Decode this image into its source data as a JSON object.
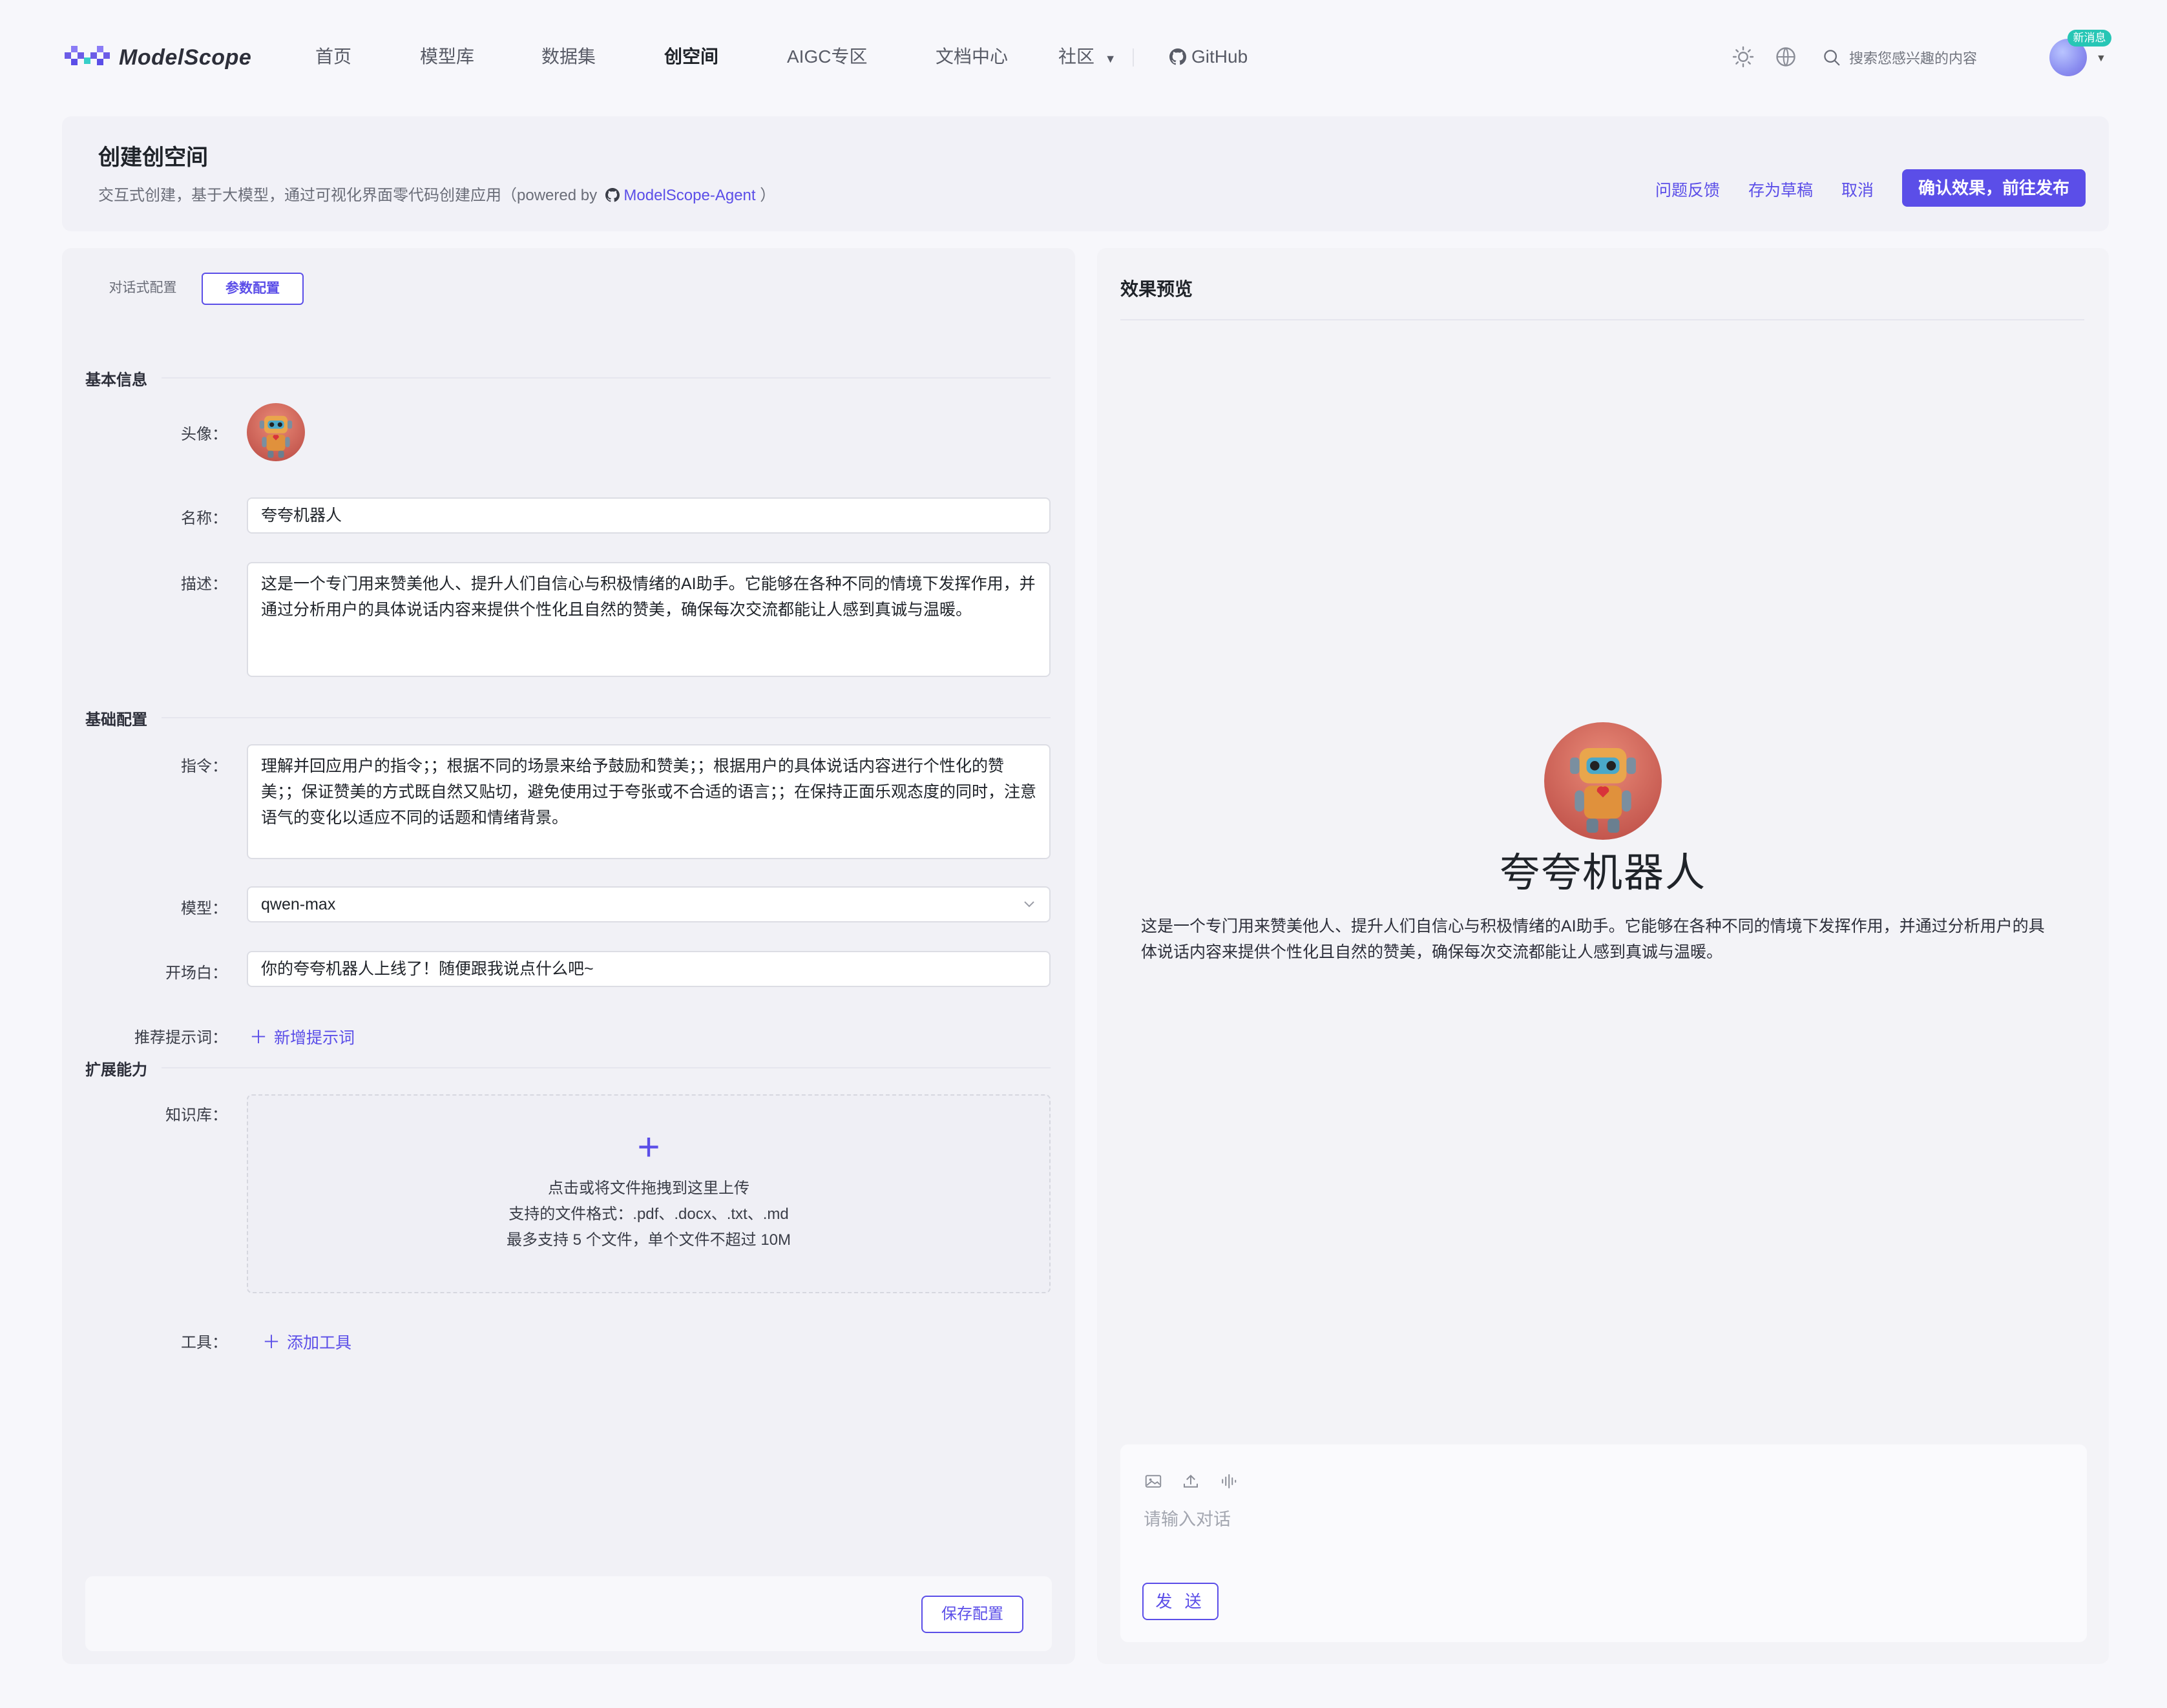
{
  "brand": {
    "name": "ModelScope"
  },
  "nav": {
    "items": [
      "首页",
      "模型库",
      "数据集",
      "创空间",
      "AIGC专区",
      "文档中心",
      "社区"
    ],
    "github": "GitHub",
    "search_placeholder": "搜索您感兴趣的内容",
    "new_badge": "新消息"
  },
  "header": {
    "title": "创建创空间",
    "subtitle_prefix": "交互式创建，基于大模型，通过可视化界面零代码创建应用（powered by",
    "subtitle_link": "ModelScope-Agent",
    "subtitle_suffix": "）",
    "feedback": "问题反馈",
    "save_draft": "存为草稿",
    "cancel": "取消",
    "publish": "确认效果，前往发布"
  },
  "config": {
    "tabs": [
      "对话式配置",
      "参数配置"
    ],
    "sections": {
      "basic_info": "基本信息",
      "basic_config": "基础配置",
      "extensions": "扩展能力"
    },
    "labels": {
      "avatar": "头像：",
      "name": "名称：",
      "description": "描述：",
      "instruction": "指令：",
      "model": "模型：",
      "opening": "开场白：",
      "suggested_prompts": "推荐提示词：",
      "knowledge": "知识库：",
      "tools": "工具："
    },
    "values": {
      "name": "夸夸机器人",
      "description": "这是一个专门用来赞美他人、提升人们自信心与积极情绪的AI助手。它能够在各种不同的情境下发挥作用，并通过分析用户的具体说话内容来提供个性化且自然的赞美，确保每次交流都能让人感到真诚与温暖。",
      "instruction": "理解并回应用户的指令；；根据不同的场景来给予鼓励和赞美；；根据用户的具体说话内容进行个性化的赞美；；保证赞美的方式既自然又贴切，避免使用过于夸张或不合适的语言；；在保持正面乐观态度的同时，注意语气的变化以适应不同的话题和情绪背景。",
      "model": "qwen-max",
      "opening": "你的夸夸机器人上线了！随便跟我说点什么吧~"
    },
    "add_prompt": "新增提示词",
    "upload": {
      "line1": "点击或将文件拖拽到这里上传",
      "line2": "支持的文件格式：.pdf、.docx、.txt、.md",
      "line3": "最多支持 5 个文件，单个文件不超过 10M"
    },
    "add_tool": "添加工具",
    "save": "保存配置"
  },
  "preview": {
    "title": "效果预览",
    "bot_name": "夸夸机器人",
    "bot_desc": "这是一个专门用来赞美他人、提升人们自信心与积极情绪的AI助手。它能够在各种不同的情境下发挥作用，并通过分析用户的具体说话内容来提供个性化且自然的赞美，确保每次交流都能让人感到真诚与温暖。",
    "input_placeholder": "请输入对话",
    "send": "发 送"
  },
  "colors": {
    "accent": "#5b4ee8",
    "badge": "#27c6b5"
  }
}
